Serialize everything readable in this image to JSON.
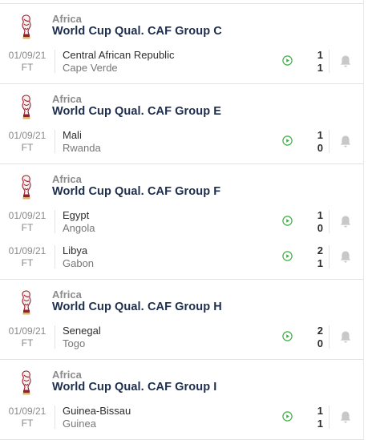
{
  "colors": {
    "accent_navy": "#1d2d4d",
    "play_green": "#3bb143",
    "bell_gray": "#c8c8c8",
    "trophy_red": "#9b1b30"
  },
  "groups": [
    {
      "region": "Africa",
      "name": "World Cup Qual. CAF Group C",
      "icon": "world-cup-trophy-icon",
      "matches": [
        {
          "date": "01/09/21",
          "status": "FT",
          "home": "Central African Republic",
          "away": "Cape Verde",
          "home_score": "1",
          "away_score": "1",
          "play_icon": "play-icon",
          "bell_icon": "bell-icon"
        }
      ]
    },
    {
      "region": "Africa",
      "name": "World Cup Qual. CAF Group E",
      "icon": "world-cup-trophy-icon",
      "matches": [
        {
          "date": "01/09/21",
          "status": "FT",
          "home": "Mali",
          "away": "Rwanda",
          "home_score": "1",
          "away_score": "0",
          "play_icon": "play-icon",
          "bell_icon": "bell-icon"
        }
      ]
    },
    {
      "region": "Africa",
      "name": "World Cup Qual. CAF Group F",
      "icon": "world-cup-trophy-icon",
      "matches": [
        {
          "date": "01/09/21",
          "status": "FT",
          "home": "Egypt",
          "away": "Angola",
          "home_score": "1",
          "away_score": "0",
          "play_icon": "play-icon",
          "bell_icon": "bell-icon"
        },
        {
          "date": "01/09/21",
          "status": "FT",
          "home": "Libya",
          "away": "Gabon",
          "home_score": "2",
          "away_score": "1",
          "play_icon": "play-icon",
          "bell_icon": "bell-icon"
        }
      ]
    },
    {
      "region": "Africa",
      "name": "World Cup Qual. CAF Group H",
      "icon": "world-cup-trophy-icon",
      "matches": [
        {
          "date": "01/09/21",
          "status": "FT",
          "home": "Senegal",
          "away": "Togo",
          "home_score": "2",
          "away_score": "0",
          "play_icon": "play-icon",
          "bell_icon": "bell-icon"
        }
      ]
    },
    {
      "region": "Africa",
      "name": "World Cup Qual. CAF Group I",
      "icon": "world-cup-trophy-icon",
      "matches": [
        {
          "date": "01/09/21",
          "status": "FT",
          "home": "Guinea-Bissau",
          "away": "Guinea",
          "home_score": "1",
          "away_score": "1",
          "play_icon": "play-icon",
          "bell_icon": "bell-icon"
        }
      ]
    }
  ]
}
